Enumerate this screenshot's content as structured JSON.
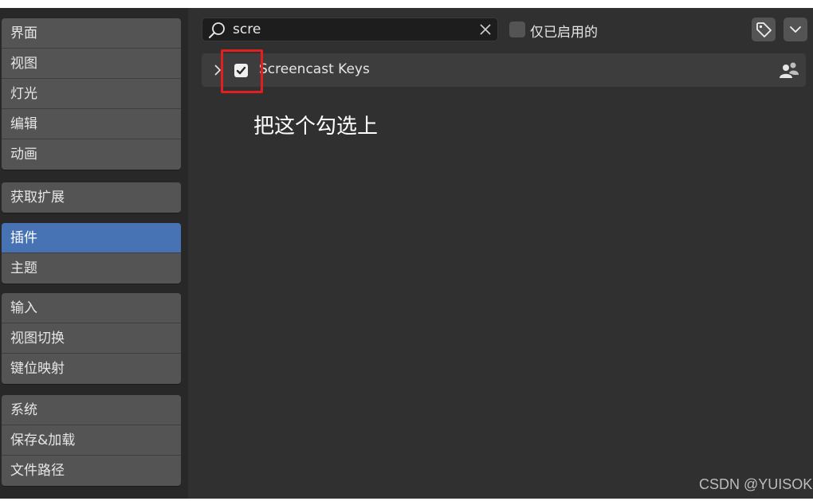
{
  "sidebar": {
    "groups": [
      [
        "界面",
        "视图",
        "灯光",
        "编辑",
        "动画"
      ],
      [
        "获取扩展"
      ],
      [
        "插件",
        "主题"
      ],
      [
        "输入",
        "视图切换",
        "键位映射"
      ],
      [
        "系统",
        "保存&加载",
        "文件路径"
      ]
    ],
    "active_item": "插件"
  },
  "search": {
    "value": "scre",
    "icon": "search-icon",
    "clear_icon": "close-icon"
  },
  "filter": {
    "enabled_only_label": "仅已启用的",
    "enabled_only_checked": false
  },
  "toolbar": {
    "tag_icon": "tag-icon",
    "dropdown_icon": "chevron-down-icon"
  },
  "addon": {
    "name": "Screencast Keys",
    "enabled": true,
    "expand_icon": "chevron-right-icon",
    "source_icon": "community-icon"
  },
  "annotation": {
    "text": "把这个勾选上",
    "highlight_color": "#e02020"
  },
  "watermark": "CSDN @YUISOK",
  "colors": {
    "accent": "#4772b3",
    "background": "#303030",
    "panel": "#545454"
  }
}
